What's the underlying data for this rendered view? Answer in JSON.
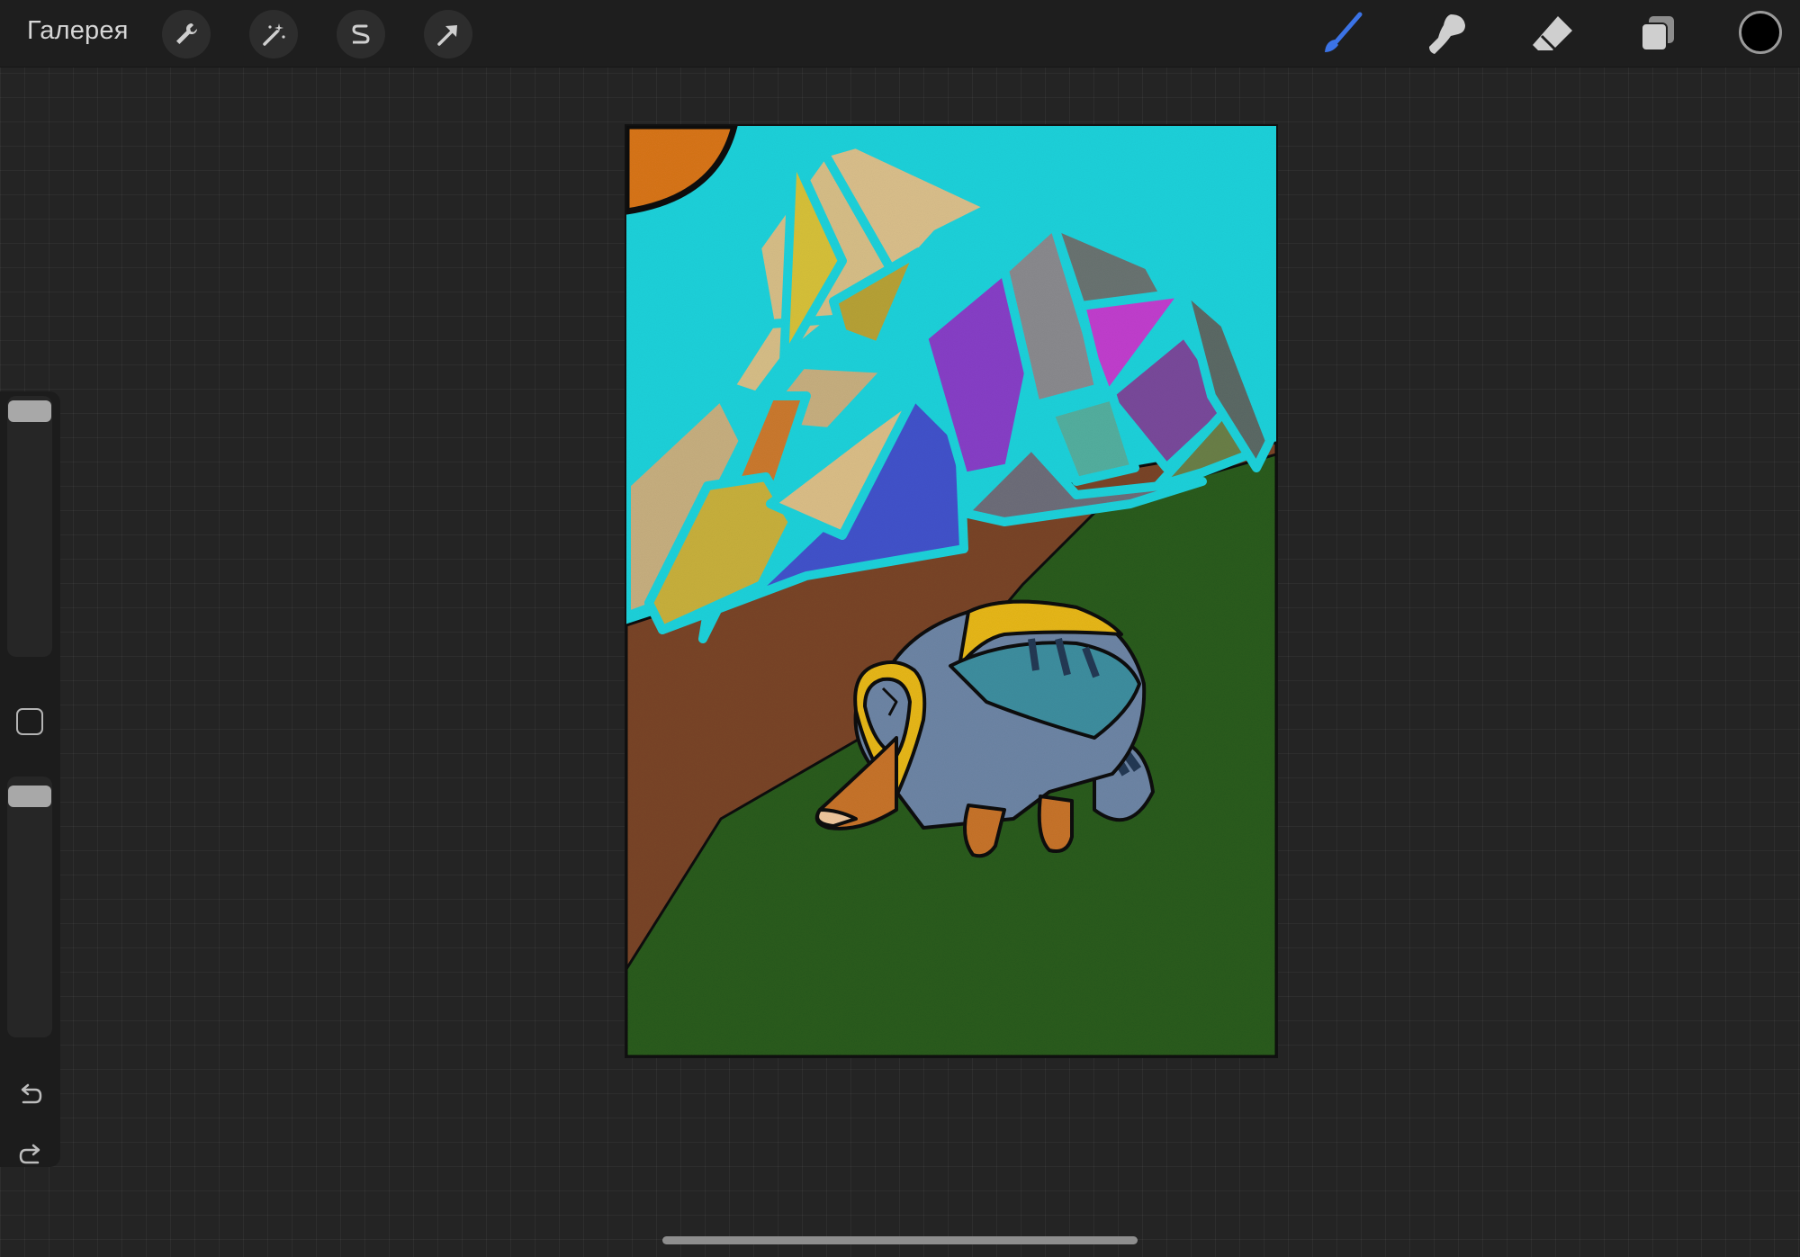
{
  "toolbar": {
    "gallery_label": "Галерея",
    "left_tools": [
      "wrench-icon",
      "magic-wand-icon",
      "selection-s-icon",
      "transform-arrow-icon"
    ],
    "right_tools": [
      "brush-icon",
      "smudge-icon",
      "eraser-icon",
      "layers-icon"
    ],
    "active_tool": "brush",
    "accent_color": "#3b73e6",
    "current_color": "#000000"
  },
  "sidebar": {
    "brush_size_level": 1.0,
    "opacity_level": 1.0,
    "controls": [
      "brush-size-slider",
      "modifier-button",
      "opacity-slider",
      "undo-button",
      "redo-button"
    ]
  },
  "canvas": {
    "artwork": "geometric-mountain-manul-illustration",
    "palette": {
      "sky": "#1fd3dc",
      "sun": "#d9761a",
      "ground_green": "#2a5c1f",
      "ground_brown": "#7a4529",
      "mountain_blue": "#3a52c8",
      "mountain_purple": "#8840c8",
      "mountain_magenta": "#c23fcf",
      "mountain_gray": "#7d7d86",
      "cat_body": "#6e86a6",
      "cat_teal": "#3e8fa0",
      "cat_yellow": "#e8b81a",
      "cat_orange": "#c8742a"
    }
  }
}
